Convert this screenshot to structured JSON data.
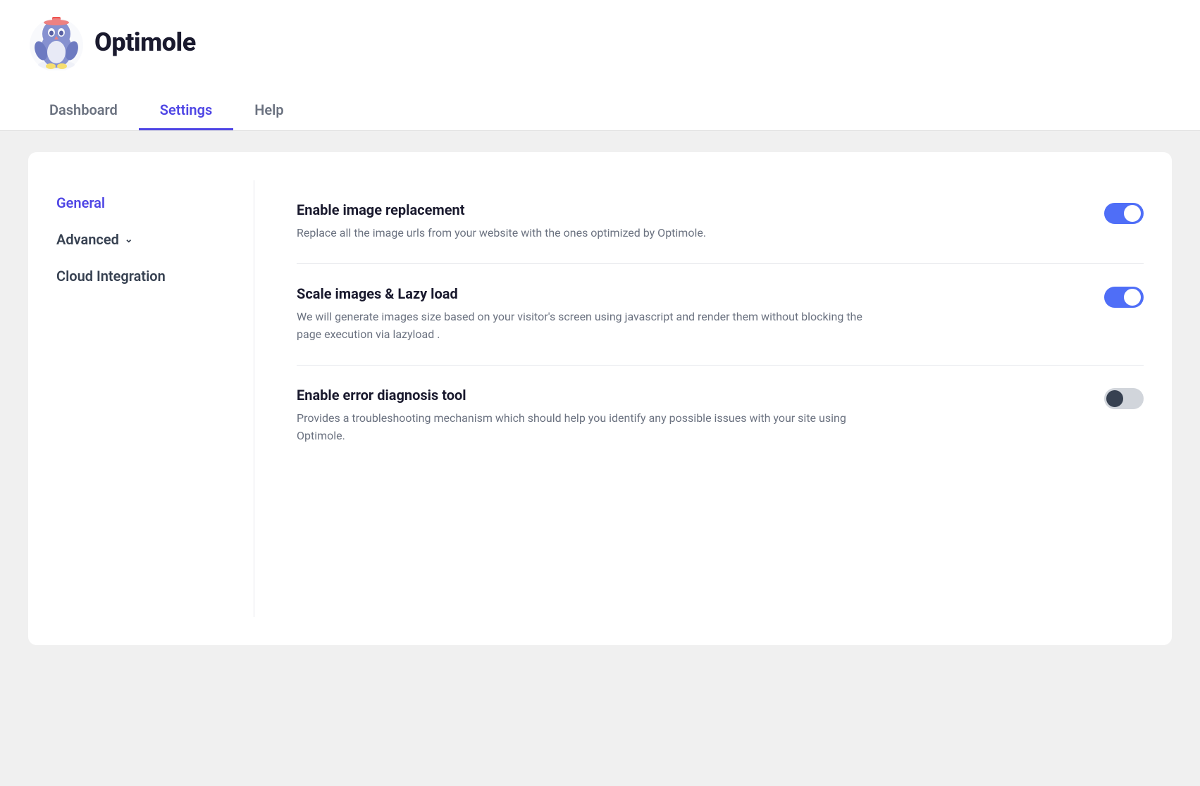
{
  "app": {
    "name": "Optimole"
  },
  "nav": {
    "tabs": [
      {
        "id": "dashboard",
        "label": "Dashboard",
        "active": false
      },
      {
        "id": "settings",
        "label": "Settings",
        "active": true
      },
      {
        "id": "help",
        "label": "Help",
        "active": false
      }
    ]
  },
  "sidebar": {
    "items": [
      {
        "id": "general",
        "label": "General",
        "active": true,
        "hasChevron": false
      },
      {
        "id": "advanced",
        "label": "Advanced",
        "active": false,
        "hasChevron": true
      },
      {
        "id": "cloud-integration",
        "label": "Cloud Integration",
        "active": false,
        "hasChevron": false
      }
    ]
  },
  "settings": [
    {
      "id": "image-replacement",
      "title": "Enable image replacement",
      "description": "Replace all the image urls from your website with the ones optimized by Optimole.",
      "enabled": true
    },
    {
      "id": "scale-lazy-load",
      "title": "Scale images & Lazy load",
      "description": "We will generate images size based on your visitor's screen using javascript and render them without blocking the page execution via lazyload .",
      "enabled": true
    },
    {
      "id": "error-diagnosis",
      "title": "Enable error diagnosis tool",
      "description": "Provides a troubleshooting mechanism which should help you identify any possible issues with your site using Optimole.",
      "enabled": false
    }
  ],
  "colors": {
    "accent": "#4f46e5",
    "toggle_on": "#4f6ef7",
    "toggle_off": "#d1d5db"
  }
}
